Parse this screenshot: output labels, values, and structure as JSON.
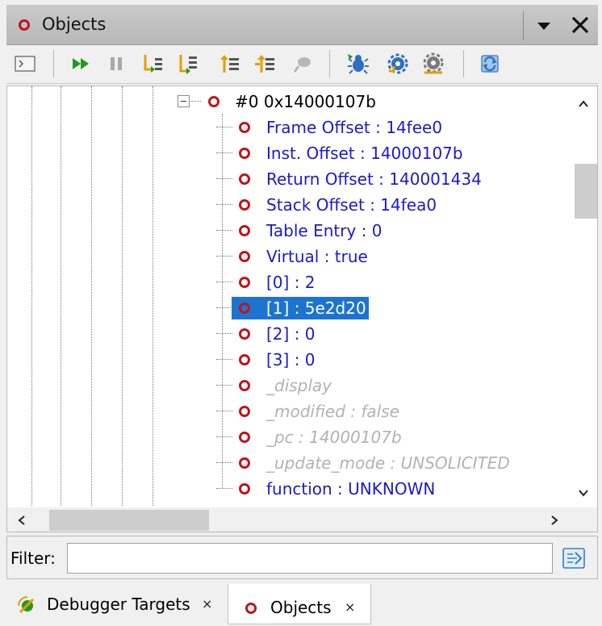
{
  "window": {
    "title": "Objects"
  },
  "toolbar": {
    "buttons": [
      {
        "name": "console-icon"
      },
      {
        "name": "resume-icon"
      },
      {
        "name": "pause-icon"
      },
      {
        "name": "step-into-icon"
      },
      {
        "name": "step-over-icon"
      },
      {
        "name": "step-out-icon"
      },
      {
        "name": "step-back-icon"
      },
      {
        "name": "interrupt-icon"
      },
      {
        "name": "debug-bug-icon"
      },
      {
        "name": "attach-gear-icon"
      },
      {
        "name": "detach-gear-icon"
      },
      {
        "name": "refresh-icon"
      }
    ]
  },
  "tree": {
    "root": {
      "label": "#0 0x14000107b"
    },
    "children": [
      {
        "label": "Frame Offset : 14fee0",
        "style": "blue"
      },
      {
        "label": "Inst. Offset : 14000107b",
        "style": "blue"
      },
      {
        "label": "Return Offset : 140001434",
        "style": "blue"
      },
      {
        "label": "Stack Offset : 14fea0",
        "style": "blue"
      },
      {
        "label": "Table Entry : 0",
        "style": "blue"
      },
      {
        "label": "Virtual : true",
        "style": "blue"
      },
      {
        "label": "[0] : 2",
        "style": "blue"
      },
      {
        "label": "[1] : 5e2d20",
        "style": "selected"
      },
      {
        "label": "[2] : 0",
        "style": "blue"
      },
      {
        "label": "[3] : 0",
        "style": "blue"
      },
      {
        "label": "_display",
        "style": "gray"
      },
      {
        "label": "_modified : false",
        "style": "gray"
      },
      {
        "label": "_pc : 14000107b",
        "style": "gray"
      },
      {
        "label": "_update_mode : UNSOLICITED",
        "style": "gray"
      },
      {
        "label": "function : UNKNOWN",
        "style": "blue"
      }
    ]
  },
  "filter": {
    "label": "Filter:",
    "value": "",
    "placeholder": ""
  },
  "tabs": [
    {
      "label": "Debugger Targets",
      "close": "×",
      "active": false
    },
    {
      "label": "Objects",
      "close": "×",
      "active": true
    }
  ],
  "colors": {
    "selection": "#1c74d0",
    "object_icon": "#c0141a",
    "tree_text": "#1a1acd",
    "gray_text": "#b2b2b2"
  }
}
